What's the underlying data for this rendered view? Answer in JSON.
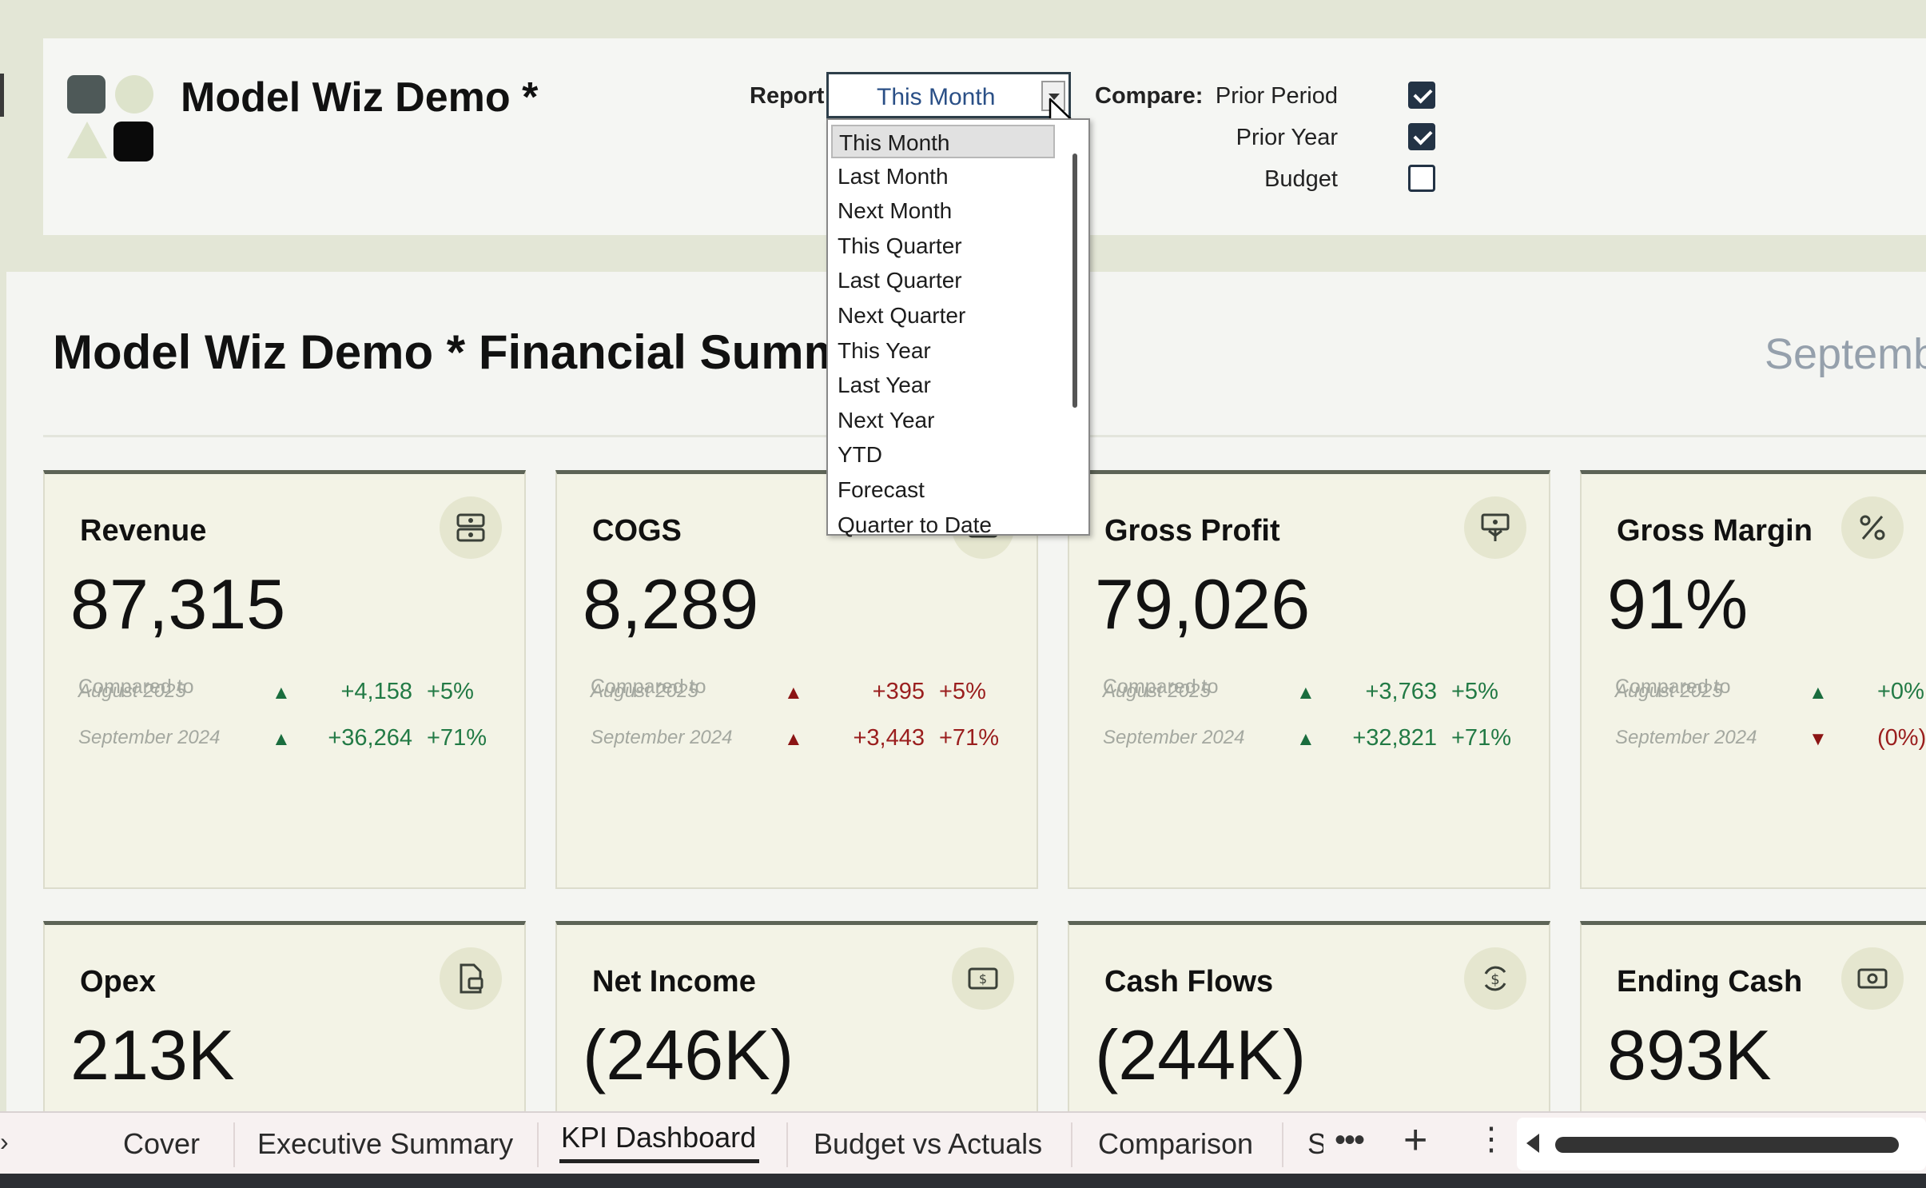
{
  "header": {
    "title": "Model Wiz Demo *",
    "report_label": "Report:",
    "report_value": "This Month",
    "compare_label": "Compare:",
    "compare_options": [
      {
        "label": "Prior Period",
        "checked": true
      },
      {
        "label": "Prior Year",
        "checked": true
      },
      {
        "label": "Budget",
        "checked": false
      }
    ]
  },
  "dropdown": {
    "options": [
      "This Month",
      "Last Month",
      "Next Month",
      "This Quarter",
      "Last Quarter",
      "Next Quarter",
      "This Year",
      "Last Year",
      "Next Year",
      "YTD",
      "Forecast",
      "Quarter to Date"
    ],
    "selected": "This Month"
  },
  "section": {
    "title": "Model Wiz Demo * Financial Summ",
    "date": "Septemb"
  },
  "compared_to": "Compared to",
  "kpis": [
    {
      "title": "Revenue",
      "value": "87,315",
      "icon": "cash-stack-icon",
      "rows": [
        {
          "label": "August 2025",
          "direction": "up",
          "delta": "+4,158",
          "pct": "+5%",
          "tone": "good"
        },
        {
          "label": "September 2024",
          "direction": "up",
          "delta": "+36,264",
          "pct": "+71%",
          "tone": "good"
        }
      ]
    },
    {
      "title": "COGS",
      "value": "8,289",
      "icon": "cash-icon",
      "rows": [
        {
          "label": "August 2025",
          "direction": "up",
          "delta": "+395",
          "pct": "+5%",
          "tone": "bad"
        },
        {
          "label": "September 2024",
          "direction": "up",
          "delta": "+3,443",
          "pct": "+71%",
          "tone": "bad"
        }
      ]
    },
    {
      "title": "Gross Profit",
      "value": "79,026",
      "icon": "money-plant-icon",
      "rows": [
        {
          "label": "August 2025",
          "direction": "up",
          "delta": "+3,763",
          "pct": "+5%",
          "tone": "good"
        },
        {
          "label": "September 2024",
          "direction": "up",
          "delta": "+32,821",
          "pct": "+71%",
          "tone": "good"
        }
      ]
    },
    {
      "title": "Gross Margin",
      "value": "91%",
      "icon": "percent-icon",
      "rows": [
        {
          "label": "August 2025",
          "direction": "up",
          "delta": "",
          "pct": "+0%",
          "tone": "good"
        },
        {
          "label": "September 2024",
          "direction": "down",
          "delta": "",
          "pct": "(0%)",
          "tone": "bad"
        }
      ]
    },
    {
      "title": "Opex",
      "value": "213K",
      "icon": "document-money-icon",
      "rows": []
    },
    {
      "title": "Net Income",
      "value": "(246K)",
      "icon": "dollar-bill-icon",
      "rows": []
    },
    {
      "title": "Cash Flows",
      "value": "(244K)",
      "icon": "dollar-cycle-icon",
      "rows": []
    },
    {
      "title": "Ending Cash",
      "value": "893K",
      "icon": "cash-icon",
      "rows": []
    }
  ],
  "tabs": [
    {
      "label": "Cover",
      "active": false
    },
    {
      "label": "Executive Summary",
      "active": false
    },
    {
      "label": "KPI Dashboard",
      "active": true
    },
    {
      "label": "Budget vs Actuals",
      "active": false
    },
    {
      "label": "Comparison",
      "active": false
    },
    {
      "label": "S",
      "active": false
    }
  ],
  "tab_controls": {
    "more": "•••",
    "add": "+",
    "menu": "⋮"
  },
  "colors": {
    "good": "#227a45",
    "bad": "#9a1e1e",
    "accent": "#5d6457",
    "band": "#e3e6d6"
  }
}
